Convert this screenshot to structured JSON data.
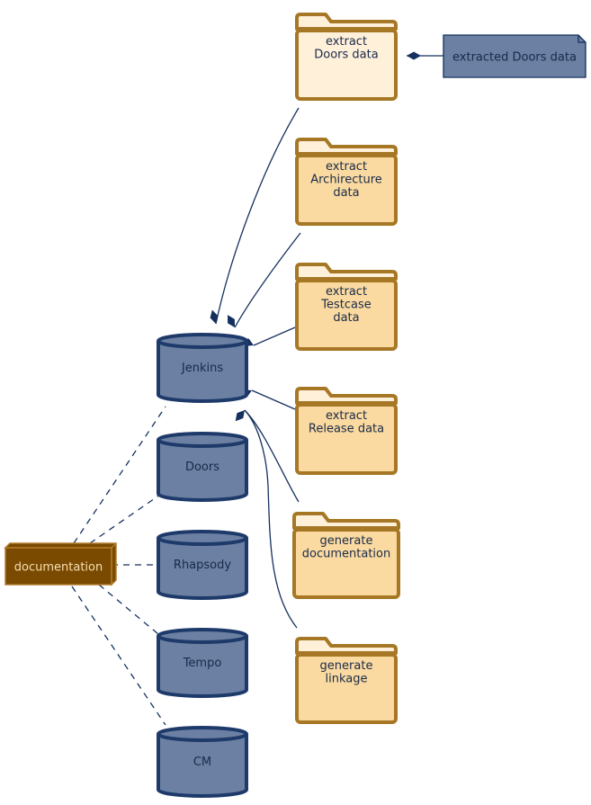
{
  "diagram": {
    "colors": {
      "folder_fill": "#fadaa0",
      "folder_fill_highlight": "#fff0da",
      "folder_tab": "#fff0da",
      "folder_stroke": "#a67826",
      "db_fill": "#6b80a2",
      "db_stroke": "#1e3a6a",
      "node_fill": "#7a4a00",
      "node_stroke": "#b07a2a",
      "note_fill": "#6b80a2",
      "note_stroke": "#15305e",
      "edge": "#15305e",
      "text": "#1a2a4a",
      "node_text": "#f5deb3"
    },
    "folders": [
      {
        "id": "extract-doors",
        "lines": [
          "extract",
          "Doors data"
        ],
        "highlight": true
      },
      {
        "id": "extract-architecture",
        "lines": [
          "extract",
          "Archirecture",
          "data"
        ]
      },
      {
        "id": "extract-testcase",
        "lines": [
          "extract",
          "Testcase",
          "data"
        ]
      },
      {
        "id": "extract-release",
        "lines": [
          "extract",
          "Release data"
        ]
      },
      {
        "id": "generate-documentation",
        "lines": [
          "generate",
          "documentation"
        ]
      },
      {
        "id": "generate-linkage",
        "lines": [
          "generate",
          "linkage"
        ]
      }
    ],
    "databases": [
      {
        "id": "jenkins",
        "label": "Jenkins"
      },
      {
        "id": "doors",
        "label": "Doors"
      },
      {
        "id": "rhapsody",
        "label": "Rhapsody"
      },
      {
        "id": "tempo",
        "label": "Tempo"
      },
      {
        "id": "cm",
        "label": "CM"
      }
    ],
    "node": {
      "id": "documentation",
      "label": "documentation"
    },
    "note": {
      "id": "extracted-doors-data",
      "label": "extracted Doors data"
    },
    "compositions": [
      {
        "from": "extract-doors",
        "to": "jenkins"
      },
      {
        "from": "extract-architecture",
        "to": "jenkins"
      },
      {
        "from": "extract-testcase",
        "to": "jenkins"
      },
      {
        "from": "extract-release",
        "to": "jenkins"
      },
      {
        "from": "generate-documentation",
        "to": "jenkins"
      },
      {
        "from": "generate-linkage",
        "to": "jenkins"
      },
      {
        "from": "extracted-doors-data",
        "to": "extract-doors"
      }
    ],
    "dependencies": [
      {
        "from": "documentation",
        "to": "jenkins"
      },
      {
        "from": "documentation",
        "to": "doors"
      },
      {
        "from": "documentation",
        "to": "rhapsody"
      },
      {
        "from": "documentation",
        "to": "tempo"
      },
      {
        "from": "documentation",
        "to": "cm"
      }
    ]
  }
}
